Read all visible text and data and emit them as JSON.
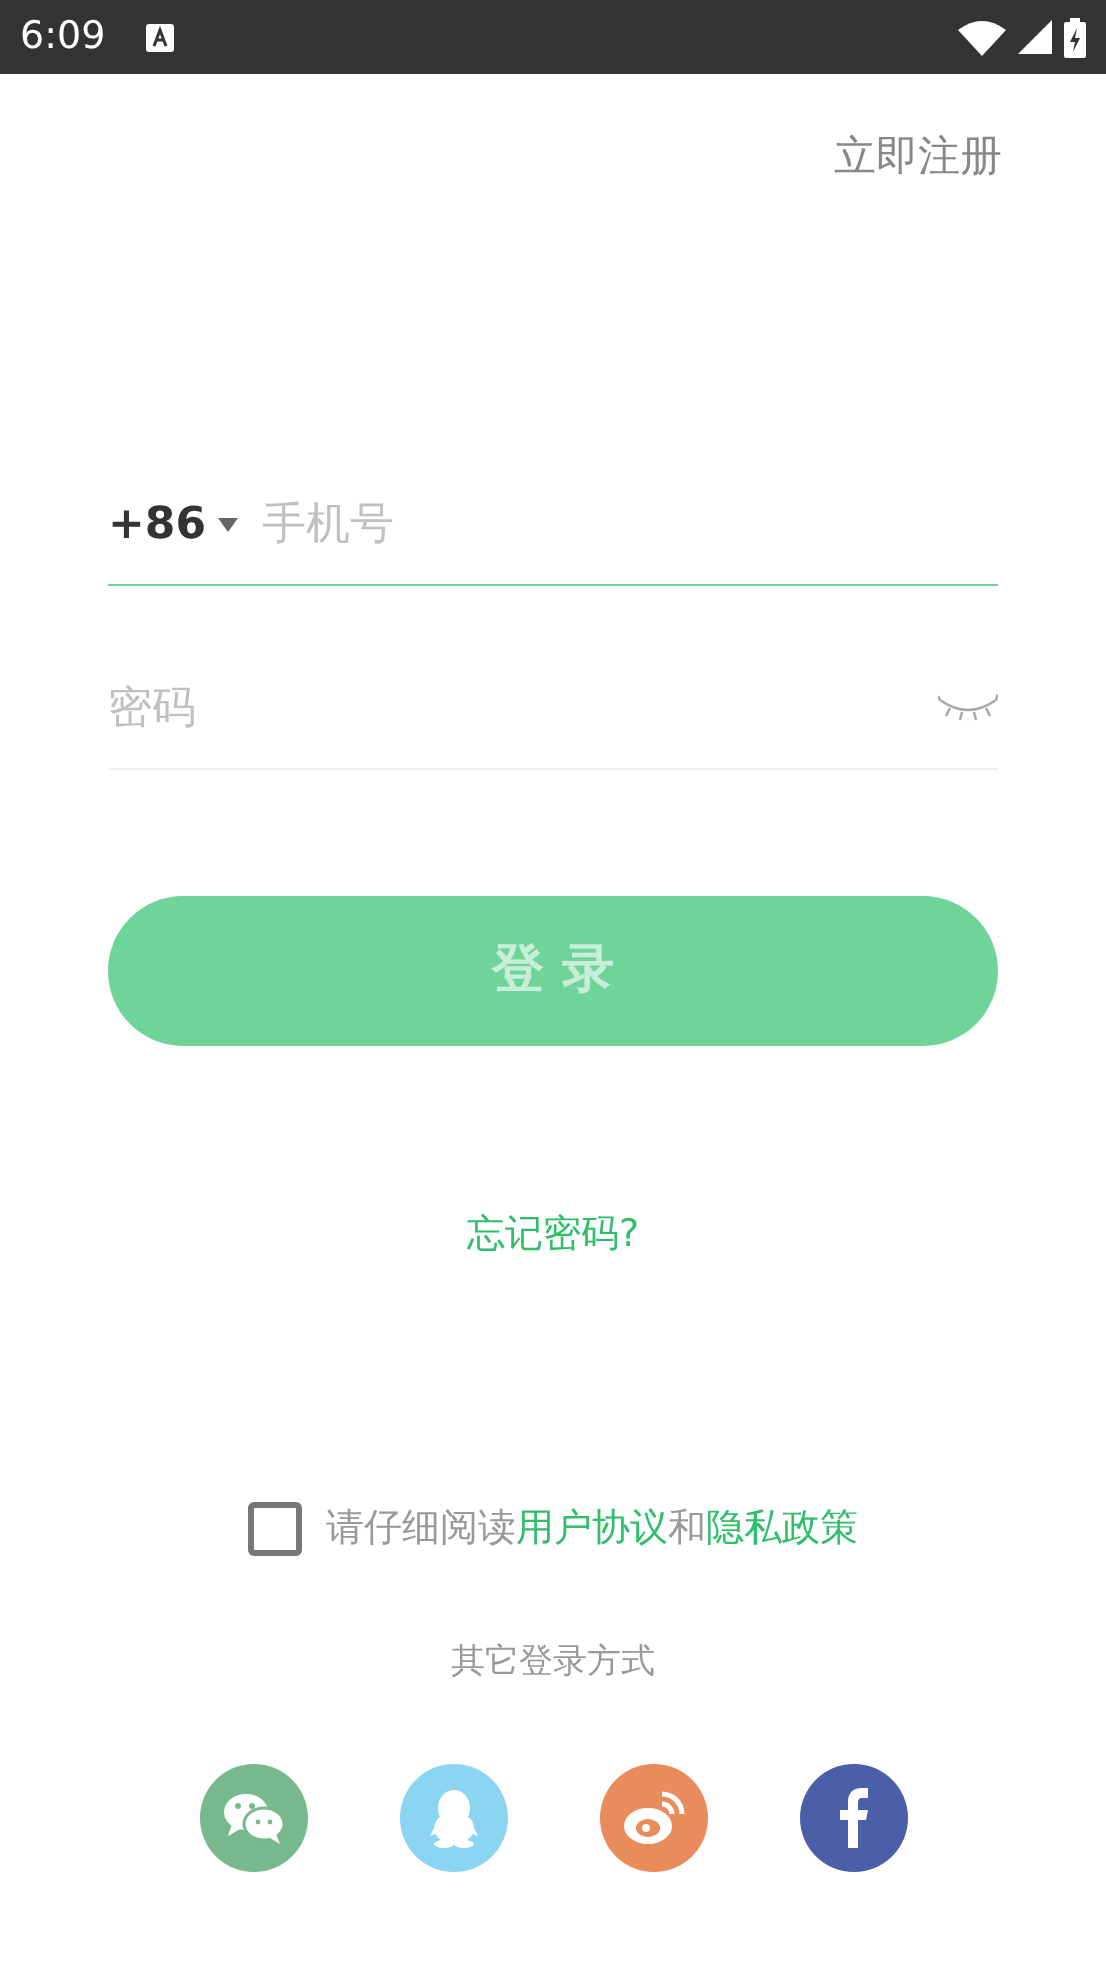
{
  "status_bar": {
    "time": "6:09"
  },
  "register_link": "立即注册",
  "phone": {
    "country_code": "+86",
    "placeholder": "手机号",
    "focused": true
  },
  "password": {
    "placeholder": "密码",
    "visible": false,
    "focused": false
  },
  "login_button": {
    "label": "登 录",
    "disabled": true
  },
  "forgot_link": "忘记密码?",
  "agreement": {
    "checked": false,
    "prefix": "请仔细阅读",
    "terms": "用户协议",
    "joiner": "和",
    "privacy": "隐私政策"
  },
  "other_login": {
    "title": "其它登录方式",
    "options": [
      {
        "kind": "chat",
        "color": "#77b98c"
      },
      {
        "kind": "penguin",
        "color": "#8bd4f2"
      },
      {
        "kind": "swirl",
        "color": "#e98b5a"
      },
      {
        "kind": "f",
        "color": "#4b5ea8"
      }
    ]
  }
}
